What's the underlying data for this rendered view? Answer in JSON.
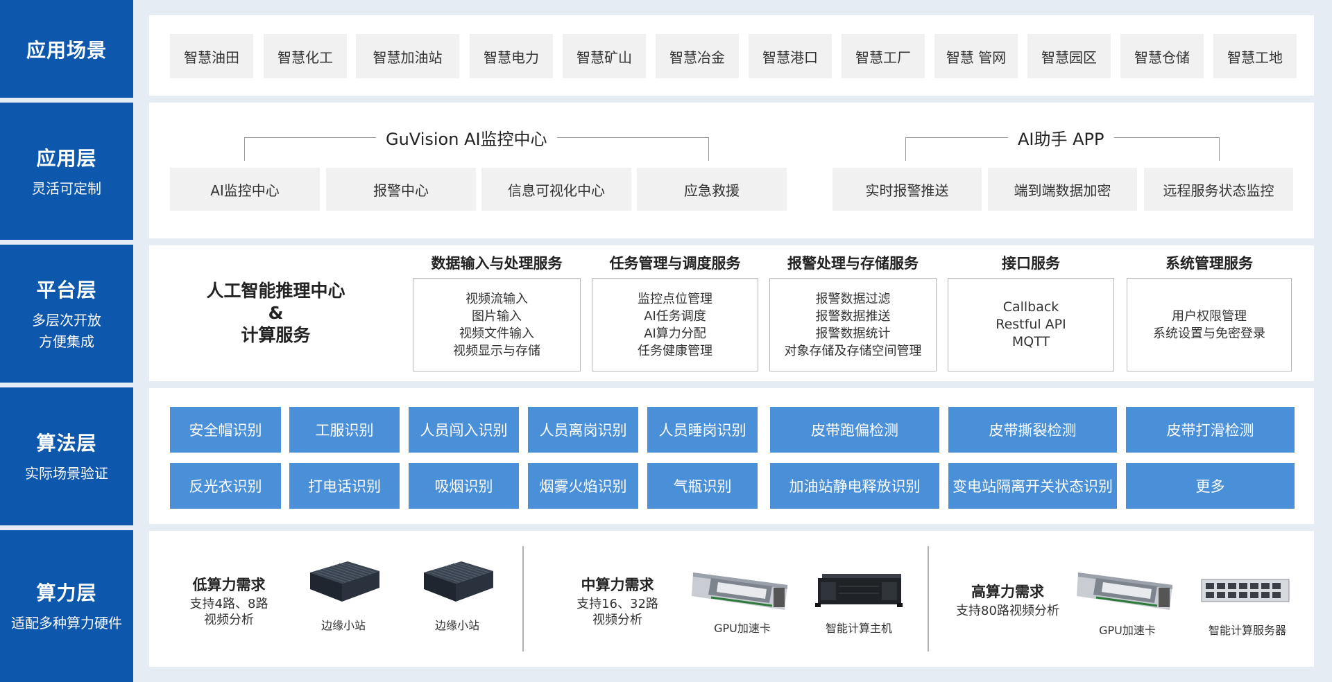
{
  "layers": [
    {
      "title": "应用场景",
      "subtitle": ""
    },
    {
      "title": "应用层",
      "subtitle": "灵活可定制"
    },
    {
      "title": "平台层",
      "subtitle_lines": [
        "多层次开放",
        "方便集成"
      ]
    },
    {
      "title": "算法层",
      "subtitle": "实际场景验证"
    },
    {
      "title": "算力层",
      "subtitle": "适配多种算力硬件"
    }
  ],
  "scenarios": [
    "智慧油田",
    "智慧化工",
    "智慧加油站",
    "智慧电力",
    "智慧矿山",
    "智慧冶金",
    "智慧港口",
    "智慧工厂",
    "智慧 管网",
    "智慧园区",
    "智慧仓储",
    "智慧工地"
  ],
  "application": {
    "groups": [
      {
        "title": "GuVision AI监控中心",
        "items": [
          "AI监控中心",
          "报警中心",
          "信息可视化中心",
          "应急救援"
        ]
      },
      {
        "title": "AI助手 APP",
        "items": [
          "实时报警推送",
          "端到端数据加密",
          "远程服务状态监控"
        ]
      }
    ]
  },
  "platform": {
    "center_lines": [
      "人工智能推理中心",
      "&",
      "计算服务"
    ],
    "services": [
      {
        "title": "数据输入与处理服务",
        "items": [
          "视频流输入",
          "图片输入",
          "视频文件输入",
          "视频显示与存储"
        ]
      },
      {
        "title": "任务管理与调度服务",
        "items": [
          "监控点位管理",
          "AI任务调度",
          "AI算力分配",
          "任务健康管理"
        ]
      },
      {
        "title": "报警处理与存储服务",
        "items": [
          "报警数据过滤",
          "报警数据推送",
          "报警数据统计",
          "对象存储及存储空间管理"
        ]
      },
      {
        "title": "接口服务",
        "items": [
          "Callback",
          "Restful API",
          "MQTT"
        ]
      },
      {
        "title": "系统管理服务",
        "items": [
          "用户权限管理",
          "系统设置与免密登录"
        ]
      }
    ]
  },
  "algorithms": {
    "row1": [
      "安全帽识别",
      "工服识别",
      "人员闯入识别",
      "人员离岗识别",
      "人员睡岗识别",
      "皮带跑偏检测",
      "皮带撕裂检测",
      "皮带打滑检测"
    ],
    "row2": [
      "反光衣识别",
      "打电话识别",
      "吸烟识别",
      "烟雾火焰识别",
      "气瓶识别",
      "加油站静电释放识别",
      "变电站隔离开关状态识别",
      "更多"
    ]
  },
  "compute": {
    "low": {
      "title": "低算力需求",
      "sub_lines": [
        "支持4路、8路",
        "视频分析"
      ],
      "devices": [
        "边缘小站",
        "边缘小站"
      ]
    },
    "mid": {
      "title": "中算力需求",
      "sub_lines": [
        "支持16、32路",
        "视频分析"
      ],
      "devices": [
        "GPU加速卡",
        "智能计算主机"
      ]
    },
    "high": {
      "title": "高算力需求",
      "sub_lines": [
        "支持80路视频分析"
      ],
      "devices": [
        "GPU加速卡",
        "智能计算服务器"
      ]
    }
  },
  "colors": {
    "layer_bg": "#0d57ad",
    "algo_box": "#4a90d9",
    "gray_box": "#f1f1f1",
    "page_bg": "#e6ecf4"
  }
}
